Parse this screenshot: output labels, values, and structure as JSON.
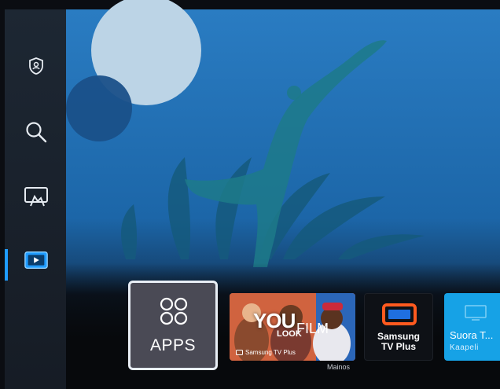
{
  "sidebar": {
    "items": [
      {
        "name": "privacy",
        "icon": "shield-user-icon"
      },
      {
        "name": "search",
        "icon": "search-icon"
      },
      {
        "name": "ambient",
        "icon": "cast-screen-icon"
      },
      {
        "name": "media",
        "icon": "play-screen-icon",
        "active": true
      }
    ]
  },
  "tiles": {
    "apps": {
      "label": "APPS",
      "icon": "apps-grid-icon"
    },
    "ad": {
      "headline": "YOU",
      "subline1": "LOOK",
      "subline2": "FILM",
      "brand": "Samsung TV Plus",
      "tag": "Mainos"
    },
    "tvplus": {
      "line1": "Samsung",
      "line2": "TV Plus",
      "icon": "tv-plus-icon"
    },
    "suora": {
      "title": "Suora T...",
      "subtitle": "Kaapeli",
      "icon": "tv-icon"
    }
  },
  "colors": {
    "hero_blue": "#1e6fb5",
    "accent": "#1f9cff",
    "sidebar": "#1a222c",
    "suora_tile": "#16a2e6"
  }
}
